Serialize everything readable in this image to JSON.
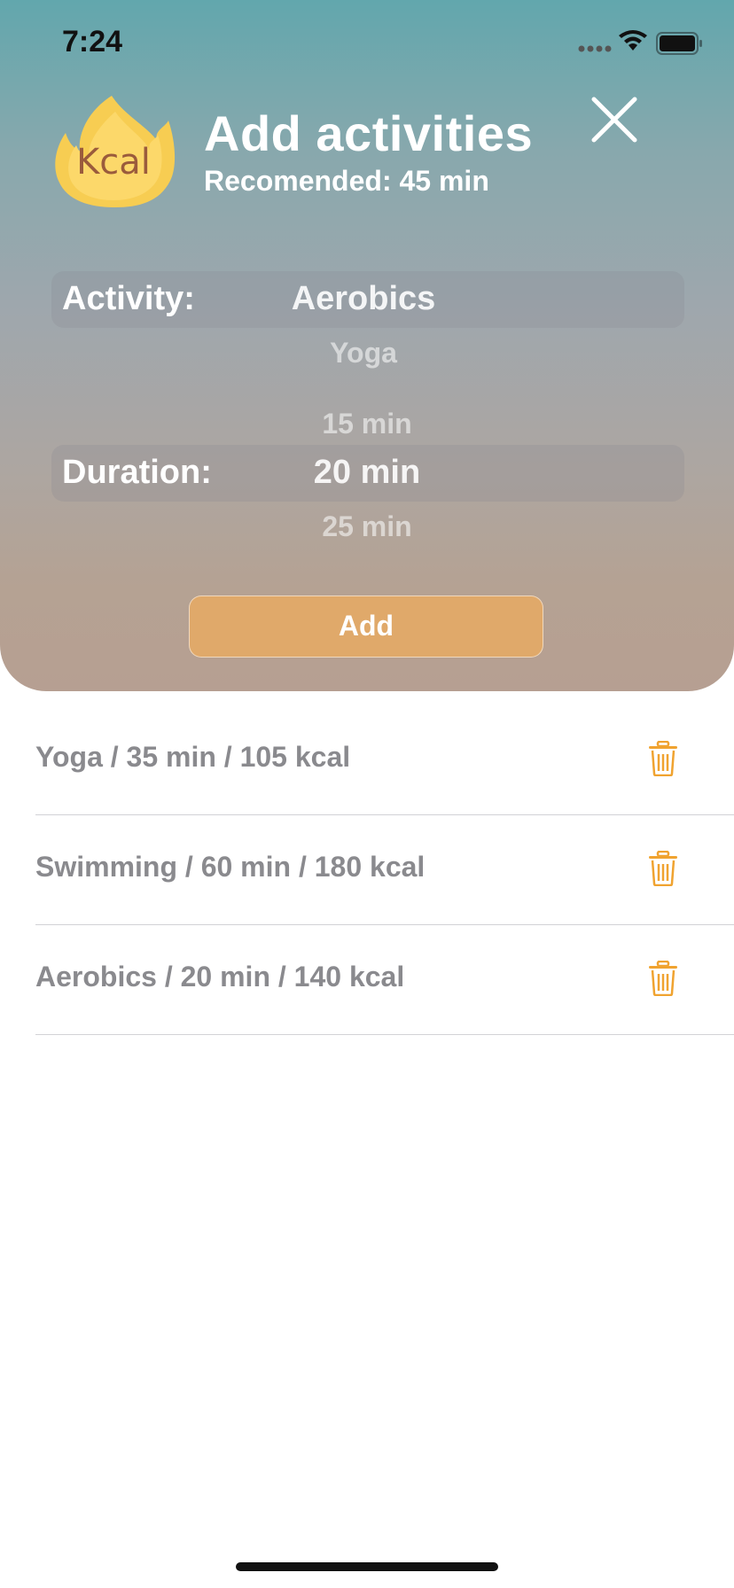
{
  "status_bar": {
    "time": "7:24"
  },
  "header": {
    "logo_text": "Kcal",
    "title": "Add activities",
    "subtitle": "Recomended: 45 min"
  },
  "activity_picker": {
    "label": "Activity:",
    "selected": "Aerobics",
    "next_option": "Yoga"
  },
  "duration_picker": {
    "label": "Duration:",
    "previous_option": "15 min",
    "selected": "20 min",
    "next_option": "25 min"
  },
  "add_button_label": "Add",
  "activities": [
    {
      "text": "Yoga / 35 min / 105 kcal"
    },
    {
      "text": "Swimming / 60 min / 180 kcal"
    },
    {
      "text": "Aerobics / 20 min / 140 kcal"
    }
  ],
  "colors": {
    "accent": "#e0a96a",
    "trash": "#f0a330",
    "list_text": "#8a8a8e"
  }
}
